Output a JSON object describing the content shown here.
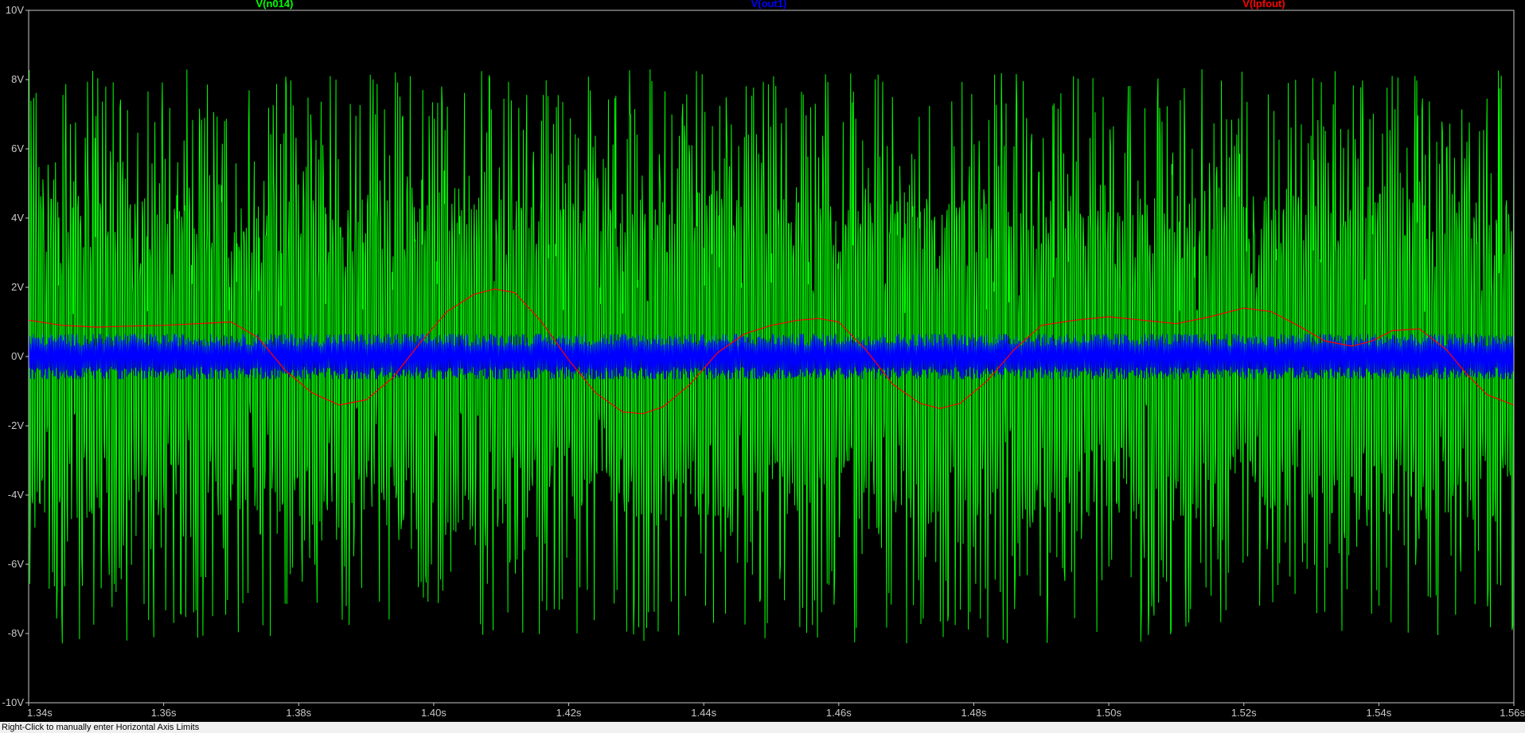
{
  "status_bar": {
    "text": "Right-Click to manually enter Horizontal Axis Limits"
  },
  "colors": {
    "background": "#000000",
    "axis": "#c8c8c8",
    "grid": "none"
  },
  "chart_data": {
    "type": "line",
    "xlim": [
      1.34,
      1.56
    ],
    "ylim": [
      -10,
      10
    ],
    "x_unit": "s",
    "y_unit": "V",
    "grid": false,
    "legend_position": "top",
    "x_ticks": [
      1.34,
      1.36,
      1.38,
      1.4,
      1.42,
      1.44,
      1.46,
      1.48,
      1.5,
      1.52,
      1.54,
      1.56
    ],
    "x_tick_labels": [
      "1.34s",
      "1.36s",
      "1.38s",
      "1.40s",
      "1.42s",
      "1.44s",
      "1.46s",
      "1.48s",
      "1.50s",
      "1.52s",
      "1.54s",
      "1.56s"
    ],
    "y_ticks": [
      10,
      8,
      6,
      4,
      2,
      0,
      -2,
      -4,
      -6,
      -8,
      -10
    ],
    "y_tick_labels": [
      "10V",
      "8V",
      "6V",
      "4V",
      "2V",
      "0V",
      "-2V",
      "-4V",
      "-6V",
      "-8V",
      "-10V"
    ],
    "series": [
      {
        "name": "V(n014)",
        "color": "#00ff00",
        "style": "dense oscillation",
        "envelope_max": 8.5,
        "envelope_min": -8.3
      },
      {
        "name": "V(out1)",
        "color": "#0000ff",
        "style": "dense oscillation",
        "envelope_max": 0.65,
        "envelope_min": -0.65
      },
      {
        "name": "V(lpfout)",
        "color": "#ff0000",
        "style": "line",
        "x": [
          1.34,
          1.345,
          1.35,
          1.355,
          1.36,
          1.365,
          1.37,
          1.374,
          1.378,
          1.382,
          1.386,
          1.39,
          1.394,
          1.398,
          1.402,
          1.406,
          1.409,
          1.412,
          1.416,
          1.42,
          1.424,
          1.428,
          1.431,
          1.434,
          1.438,
          1.442,
          1.446,
          1.45,
          1.454,
          1.457,
          1.46,
          1.464,
          1.468,
          1.472,
          1.475,
          1.478,
          1.482,
          1.486,
          1.49,
          1.495,
          1.5,
          1.505,
          1.51,
          1.515,
          1.52,
          1.524,
          1.528,
          1.532,
          1.536,
          1.539,
          1.542,
          1.546,
          1.55,
          1.553,
          1.556,
          1.56
        ],
        "y": [
          1.05,
          0.9,
          0.85,
          0.88,
          0.9,
          0.95,
          1.0,
          0.55,
          -0.4,
          -1.05,
          -1.4,
          -1.25,
          -0.6,
          0.4,
          1.3,
          1.8,
          1.95,
          1.85,
          1.0,
          -0.1,
          -1.05,
          -1.6,
          -1.65,
          -1.45,
          -0.8,
          0.1,
          0.65,
          0.9,
          1.05,
          1.1,
          1.0,
          0.2,
          -0.8,
          -1.35,
          -1.5,
          -1.35,
          -0.7,
          0.2,
          0.9,
          1.05,
          1.15,
          1.05,
          0.95,
          1.15,
          1.4,
          1.3,
          0.9,
          0.45,
          0.3,
          0.45,
          0.75,
          0.8,
          0.2,
          -0.5,
          -1.1,
          -1.4
        ]
      }
    ]
  }
}
